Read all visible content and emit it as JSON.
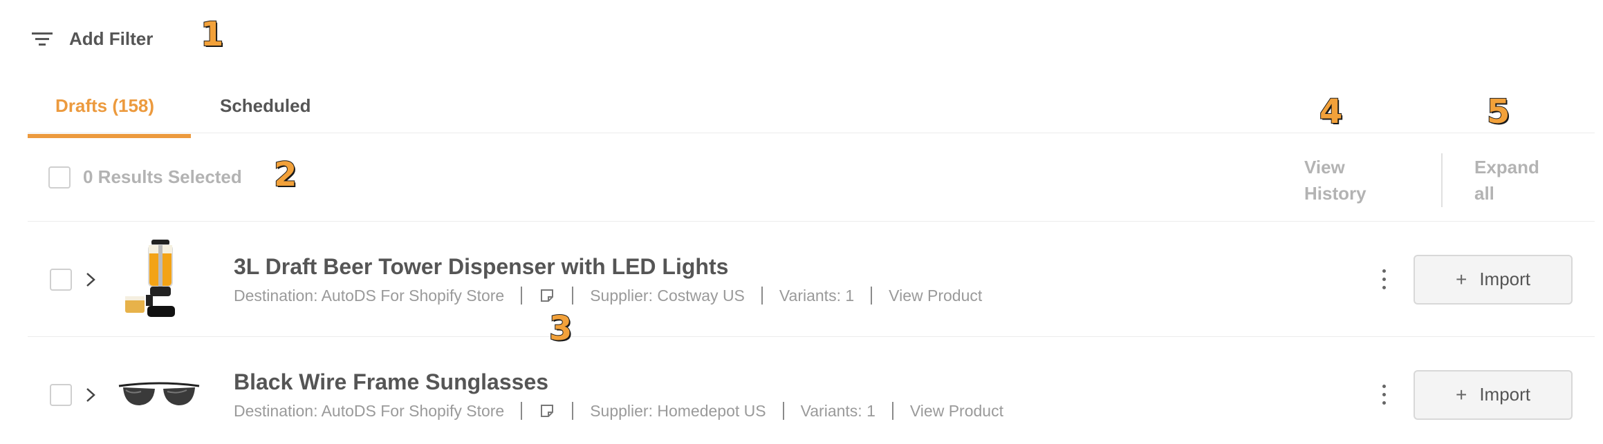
{
  "filter": {
    "label": "Add Filter",
    "icon": "filter-lines-icon"
  },
  "tabs": [
    {
      "label": "Drafts (158)",
      "active": true
    },
    {
      "label": "Scheduled",
      "active": false
    }
  ],
  "toolbar": {
    "results_selected": "0 Results Selected",
    "view_history": "View History",
    "expand_all": "Expand all"
  },
  "products": [
    {
      "title": "3L Draft Beer Tower Dispenser with LED Lights",
      "destination": "Destination: AutoDS For Shopify Store",
      "supplier": "Supplier: Costway US",
      "variants": "Variants: 1",
      "view_product": "View Product",
      "thumb_icon": "beer-tower-image",
      "import_label": "Import"
    },
    {
      "title": "Black Wire Frame Sunglasses",
      "destination": "Destination: AutoDS For Shopify Store",
      "supplier": "Supplier: Homedepot US",
      "variants": "Variants: 1",
      "view_product": "View Product",
      "thumb_icon": "sunglasses-image",
      "import_label": "Import"
    }
  ],
  "annotations": [
    "1",
    "2",
    "3",
    "4",
    "5"
  ],
  "colors": {
    "accent": "#ec9a3e",
    "muted_text": "#b3b3b3",
    "marker_fill": "#f2a13a"
  }
}
